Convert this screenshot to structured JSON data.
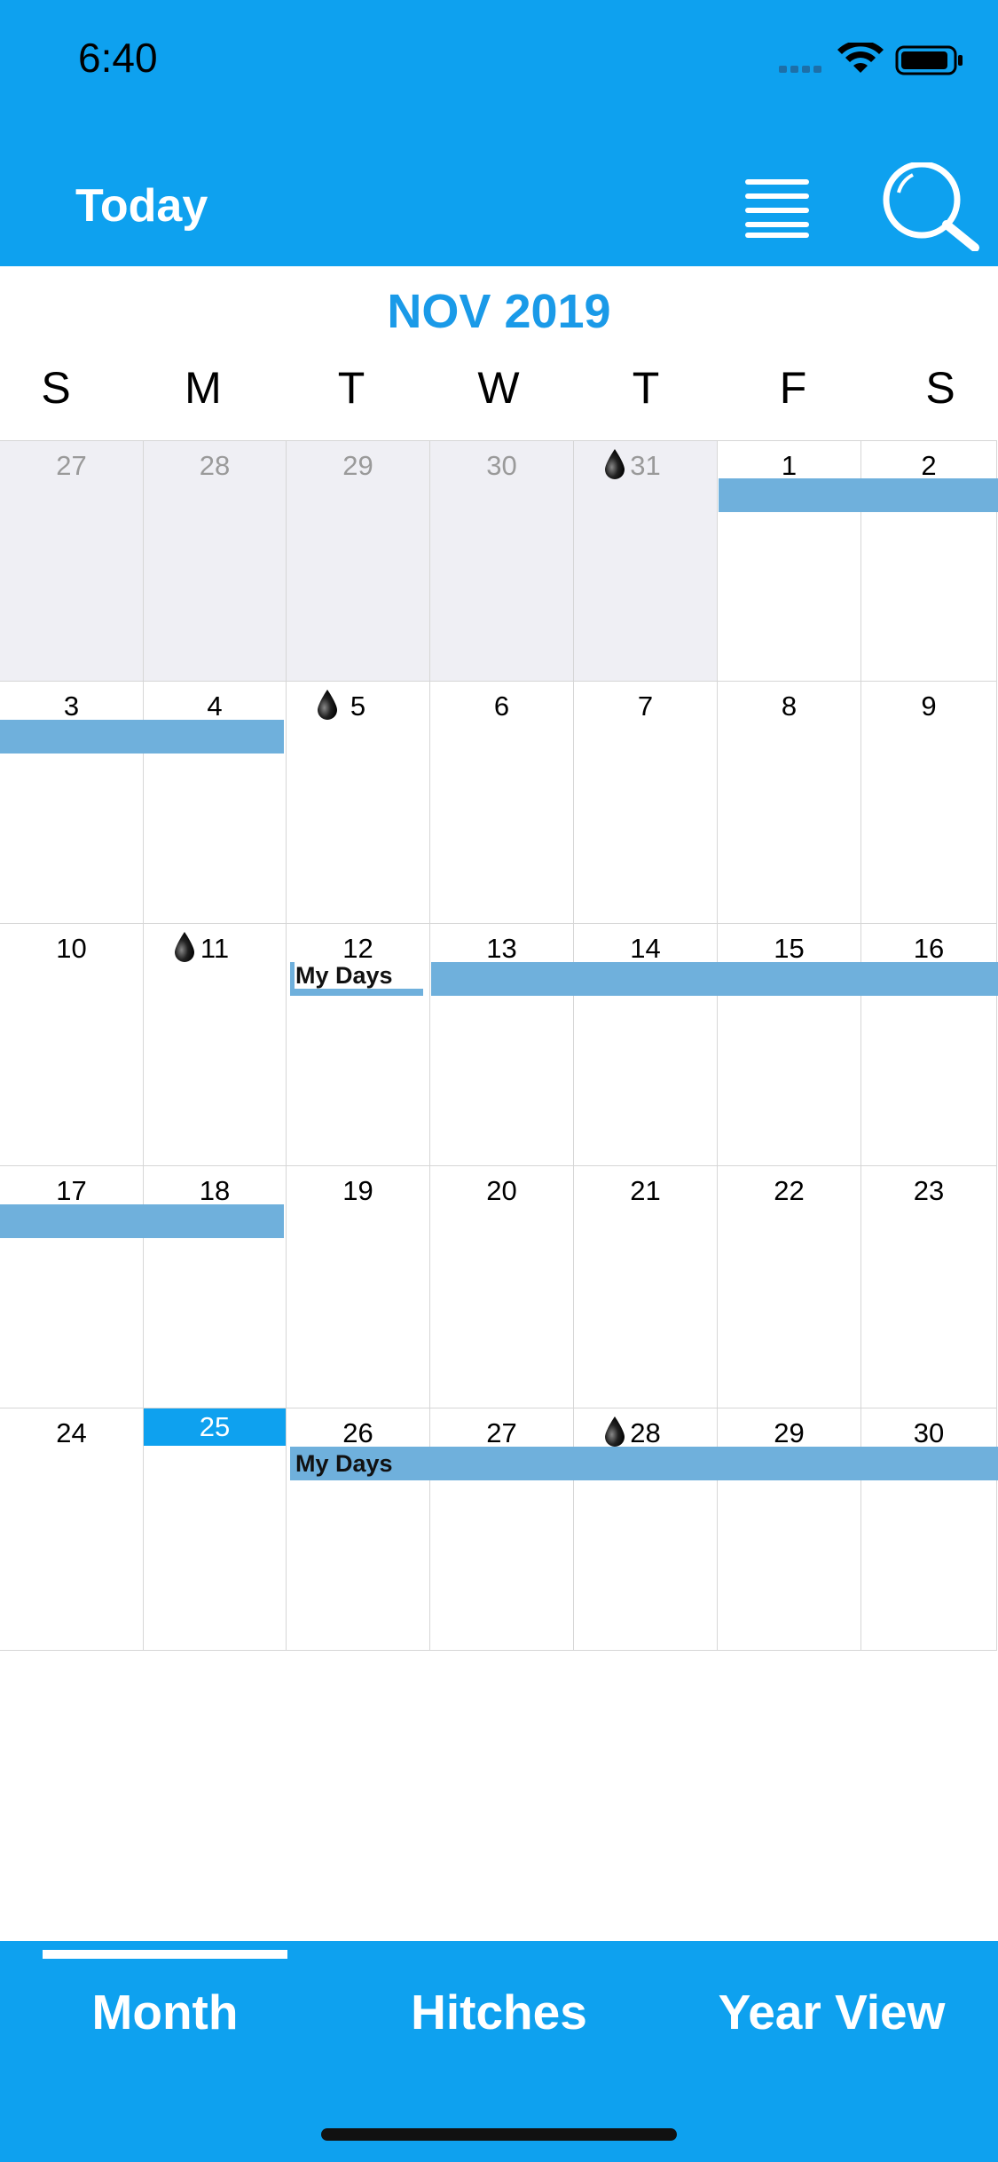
{
  "status": {
    "time": "6:40"
  },
  "navbar": {
    "today_label": "Today"
  },
  "calendar": {
    "month_title": "NOV 2019",
    "weekdays": [
      "S",
      "M",
      "T",
      "W",
      "T",
      "F",
      "S"
    ],
    "rows": [
      [
        "27",
        "28",
        "29",
        "30",
        "31",
        "1",
        "2"
      ],
      [
        "3",
        "4",
        "5",
        "6",
        "7",
        "8",
        "9"
      ],
      [
        "10",
        "11",
        "12",
        "13",
        "14",
        "15",
        "16"
      ],
      [
        "17",
        "18",
        "19",
        "20",
        "21",
        "22",
        "23"
      ],
      [
        "24",
        "25",
        "26",
        "27",
        "28",
        "29",
        "30"
      ]
    ],
    "event_label": "My Days",
    "today": "25",
    "colors": {
      "accent": "#0ea1ef",
      "event": "#6fb0dc",
      "out_of_month": "#efeff4"
    }
  },
  "tabs": [
    "Month",
    "Hitches",
    "Year View"
  ]
}
